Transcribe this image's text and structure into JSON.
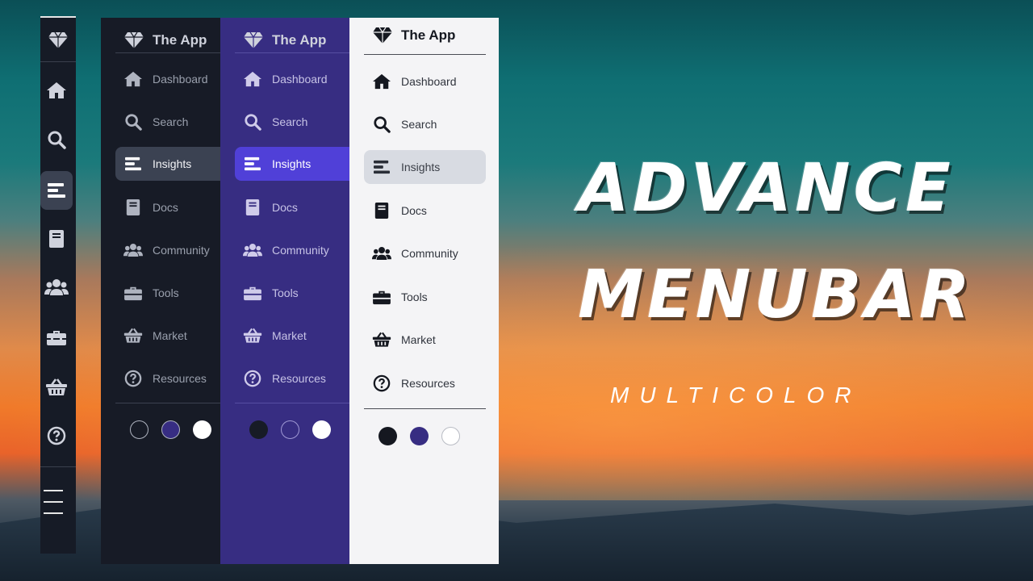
{
  "brand": {
    "name": "The App"
  },
  "menu": [
    {
      "label": "Dashboard",
      "icon": "home-icon"
    },
    {
      "label": "Search",
      "icon": "search-icon"
    },
    {
      "label": "Insights",
      "icon": "insights-icon",
      "active": true
    },
    {
      "label": "Docs",
      "icon": "book-icon"
    },
    {
      "label": "Community",
      "icon": "users-icon"
    },
    {
      "label": "Tools",
      "icon": "toolbox-icon"
    },
    {
      "label": "Market",
      "icon": "basket-icon"
    },
    {
      "label": "Resources",
      "icon": "question-circle-icon"
    }
  ],
  "themes": [
    {
      "name": "dark",
      "color": "#171b26",
      "selected": false
    },
    {
      "name": "purple",
      "color": "#372d82",
      "selected": false
    },
    {
      "name": "light",
      "color": "#ffffff",
      "selected": false
    }
  ],
  "headline": {
    "line1": "ADVANCE",
    "line2": "MENUBAR",
    "subtitle": "MULTICOLOR"
  },
  "colors": {
    "dark_bg": "#171b26",
    "purple_bg": "#372d82",
    "light_bg": "#f4f4f6",
    "purple_active": "#5040d8"
  }
}
